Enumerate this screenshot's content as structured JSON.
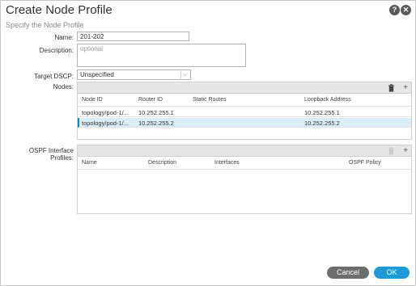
{
  "dialog": {
    "title": "Create Node Profile",
    "subtitle": "Specify the Node Profile",
    "help_icon": "?",
    "close_icon": "✕"
  },
  "form": {
    "name_label": "Name:",
    "name_value": "201-202",
    "description_label": "Description:",
    "description_placeholder": "optional",
    "target_dscp_label": "Target DSCP:",
    "target_dscp_value": "Unspecified",
    "nodes_label": "Nodes:",
    "ospf_label": "OSPF Interface Profiles:"
  },
  "nodes_table": {
    "columns": [
      "Node ID",
      "Router ID",
      "Static Routes",
      "Loopback Address"
    ],
    "rows": [
      {
        "node_id": "topology/pod-1/...",
        "router_id": "10.252.255.1",
        "static_routes": "",
        "loopback": "10.252.255.1",
        "selected": false
      },
      {
        "node_id": "topology/pod-1/...",
        "router_id": "10.252.255.2",
        "static_routes": "",
        "loopback": "10.252.255.2",
        "selected": true
      }
    ]
  },
  "ospf_table": {
    "columns": [
      "Name",
      "Description",
      "Interfaces",
      "OSPF Policy"
    ]
  },
  "icons": {
    "trash": "trash-icon",
    "add": "plus-icon",
    "add_glyph": "+"
  },
  "buttons": {
    "cancel": "Cancel",
    "ok": "OK"
  },
  "colors": {
    "accent": "#1e9bd7",
    "selected_row": "#d9edf7",
    "cancel": "#6d6d6d"
  }
}
